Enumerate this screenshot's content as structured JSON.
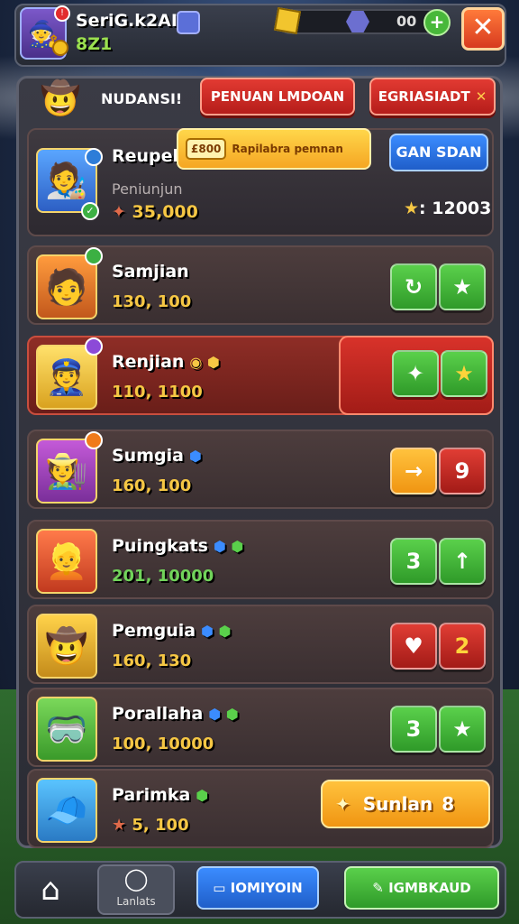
{
  "header": {
    "player_name": "SeriG.k2AI",
    "player_score": "8Z1",
    "resource_value": "00",
    "plus": "+",
    "close": "✕"
  },
  "panel": {
    "title": "NUDANSI!",
    "btn_primary": "PENUAN LMDOAN",
    "btn_secondary": "EGRIASIADT"
  },
  "featured": {
    "name": "Reupeli",
    "banner_tag": "£800",
    "banner_text": "Rapilabra pemnan",
    "action": "GAN SDAN",
    "subtitle": "Peniunjun",
    "score": "35,000",
    "stars": ": 12003"
  },
  "rows": [
    {
      "name": "Samjian",
      "score": "130, 100",
      "left": "↻",
      "right": "★"
    },
    {
      "name": "Renjian",
      "score": "110, 1100",
      "left": "✦",
      "right": "★"
    },
    {
      "name": "Sumgia",
      "score": "160, 100",
      "left": "→",
      "right": "9"
    },
    {
      "name": "Puingkats",
      "score": "201, 10000",
      "left": "3",
      "right": "↑"
    },
    {
      "name": "Pemguia",
      "score": "160, 130",
      "left": "♥",
      "right": "2"
    },
    {
      "name": "Porallaha",
      "score": "100, 10000",
      "left": "3",
      "right": "★"
    },
    {
      "name": "Parimka",
      "score": "5, 100",
      "action": "Sunlan",
      "action_num": "8"
    }
  ],
  "bottom": {
    "labs_label": "Lanlats",
    "blue_label": "IOMIYOIN",
    "green_label": "IGMBKAUD"
  }
}
